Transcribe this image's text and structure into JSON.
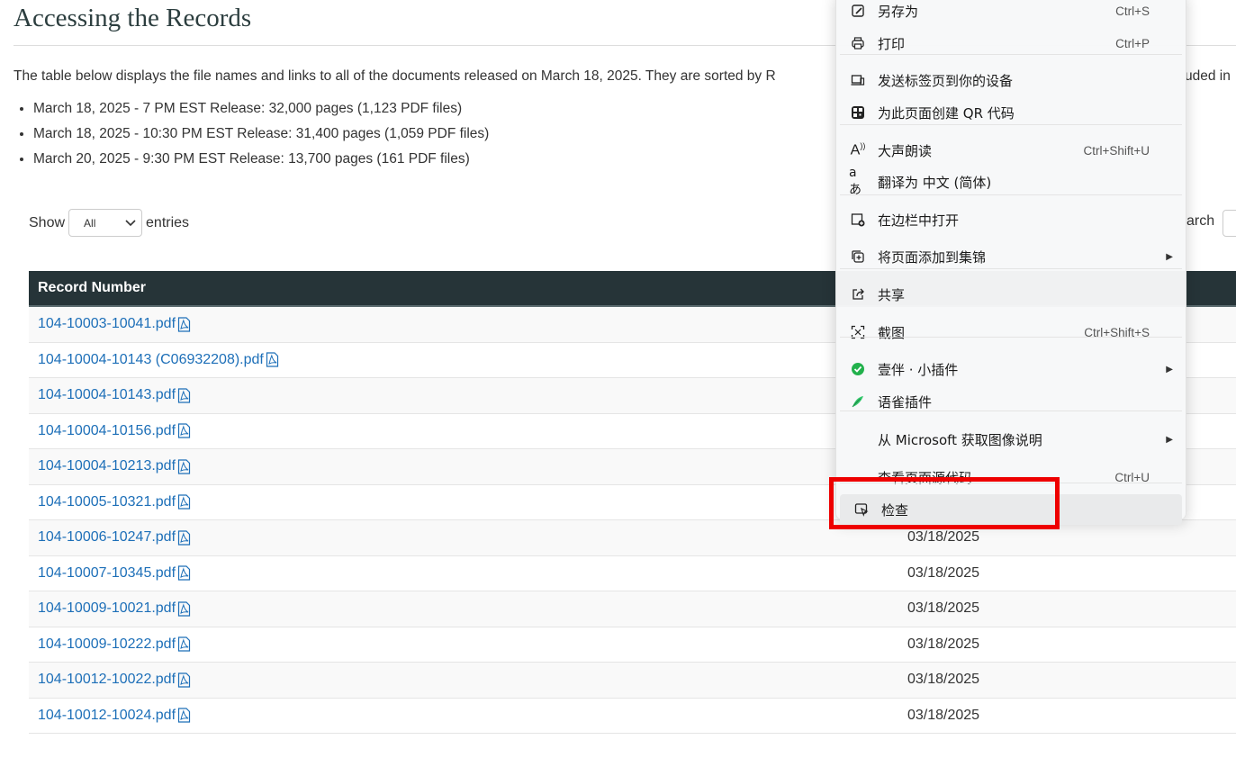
{
  "page": {
    "title": "Accessing the Records",
    "intro": "The table below displays the file names and links to all of the documents released on March 18, 2025.  They are sorted by R",
    "intro_tail": "uded in",
    "releases": [
      "March 18, 2025 - 7 PM EST Release: 32,000 pages (1,123 PDF files)",
      "March 18, 2025 - 10:30 PM EST Release: 31,400 pages (1,059 PDF files)",
      "March 20, 2025 - 9:30 PM EST Release: 13,700 pages (161 PDF files)"
    ]
  },
  "controls": {
    "show_label": "Show",
    "show_value": "All",
    "entries_label": "entries",
    "search_label": "arch"
  },
  "table": {
    "header": "Record Number",
    "rows": [
      {
        "record": "104-10003-10041.pdf",
        "date": ""
      },
      {
        "record": "104-10004-10143 (C06932208).pdf",
        "date": ""
      },
      {
        "record": "104-10004-10143.pdf",
        "date": ""
      },
      {
        "record": "104-10004-10156.pdf",
        "date": ""
      },
      {
        "record": "104-10004-10213.pdf",
        "date": ""
      },
      {
        "record": "104-10005-10321.pdf",
        "date": ""
      },
      {
        "record": "104-10006-10247.pdf",
        "date": "03/18/2025"
      },
      {
        "record": "104-10007-10345.pdf",
        "date": "03/18/2025"
      },
      {
        "record": "104-10009-10021.pdf",
        "date": "03/18/2025"
      },
      {
        "record": "104-10009-10222.pdf",
        "date": "03/18/2025"
      },
      {
        "record": "104-10012-10022.pdf",
        "date": "03/18/2025"
      },
      {
        "record": "104-10012-10024.pdf",
        "date": "03/18/2025"
      }
    ]
  },
  "context_menu": {
    "items": [
      {
        "label": "另存为",
        "shortcut": "Ctrl+S",
        "icon": "save-as-icon"
      },
      {
        "label": "打印",
        "shortcut": "Ctrl+P",
        "icon": "print-icon"
      },
      {
        "label": "发送标签页到你的设备",
        "shortcut": "",
        "icon": "send-to-device-icon"
      },
      {
        "label": "为此页面创建 QR 代码",
        "shortcut": "",
        "icon": "qr-code-icon"
      },
      {
        "label": "大声朗读",
        "shortcut": "Ctrl+Shift+U",
        "icon": "read-aloud-icon"
      },
      {
        "label": "翻译为 中文 (简体)",
        "shortcut": "",
        "icon": "translate-icon"
      },
      {
        "label": "在边栏中打开",
        "shortcut": "",
        "icon": "sidebar-open-icon"
      },
      {
        "label": "将页面添加到集锦",
        "shortcut": "",
        "icon": "collections-icon"
      },
      {
        "label": "共享",
        "shortcut": "",
        "icon": "share-icon"
      },
      {
        "label": "截图",
        "shortcut": "Ctrl+Shift+S",
        "icon": "screenshot-icon"
      },
      {
        "label": "壹伴 · 小插件",
        "shortcut": "",
        "icon": "yiban-extension-icon"
      },
      {
        "label": "语雀插件",
        "shortcut": "",
        "icon": "yuque-extension-icon"
      },
      {
        "label": "从 Microsoft 获取图像说明",
        "shortcut": "",
        "icon": ""
      },
      {
        "label": "查看页面源代码",
        "shortcut": "Ctrl+U",
        "icon": ""
      },
      {
        "label": "检查",
        "shortcut": "",
        "icon": "inspect-icon"
      }
    ]
  },
  "colors": {
    "link": "#1d6fb8",
    "table_header_bg": "#263438",
    "highlight_box": "#ee0000",
    "extension_green": "#22b14c"
  }
}
